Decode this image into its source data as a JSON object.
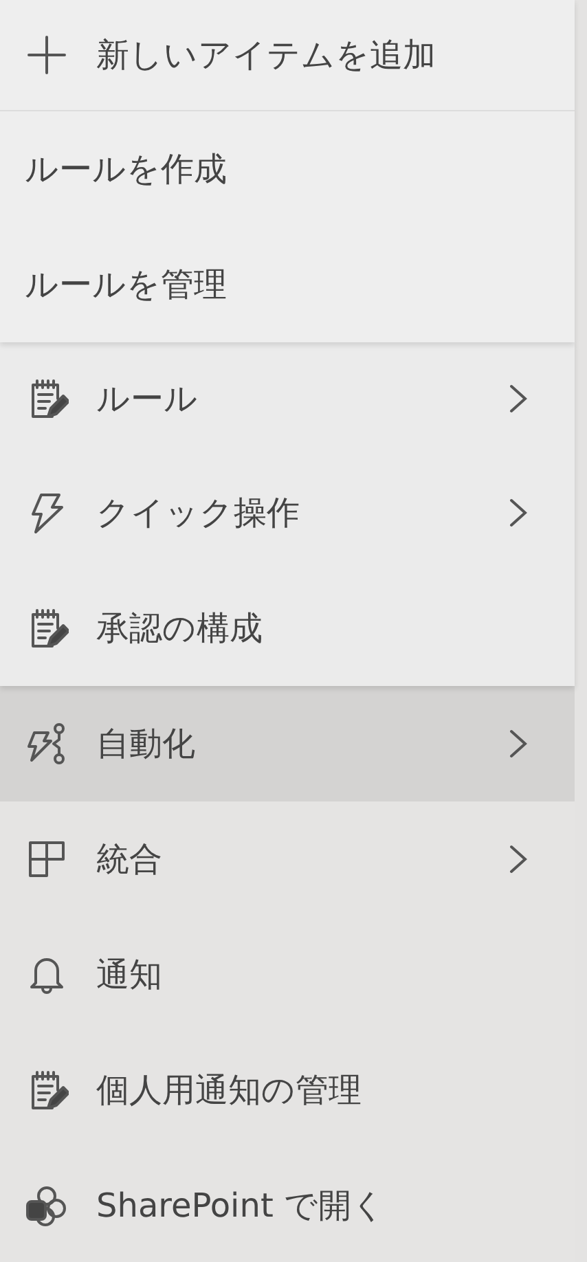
{
  "menus": [
    {
      "items": [
        {
          "kind": "plus",
          "label": "新しいアイテムを追加",
          "submenu": false,
          "selected": false
        },
        {
          "kind": "text",
          "label": "ルールを作成",
          "submenu": false,
          "selected": false
        },
        {
          "kind": "text",
          "label": "ルールを管理",
          "submenu": false,
          "selected": false
        }
      ]
    },
    {
      "items": [
        {
          "kind": "note",
          "label": "ルール",
          "submenu": true,
          "selected": false
        },
        {
          "kind": "bolt",
          "label": "クイック操作",
          "submenu": true,
          "selected": false
        },
        {
          "kind": "note",
          "label": "承認の構成",
          "submenu": false,
          "selected": false
        }
      ]
    },
    {
      "items": [
        {
          "kind": "flow",
          "label": "自動化",
          "submenu": true,
          "selected": true
        },
        {
          "kind": "grid",
          "label": "統合",
          "submenu": true,
          "selected": false
        },
        {
          "kind": "bell",
          "label": "通知",
          "submenu": false,
          "selected": false
        },
        {
          "kind": "note",
          "label": "個人用通知の管理",
          "submenu": false,
          "selected": false
        },
        {
          "kind": "sharepoint",
          "label": "SharePoint で開く",
          "submenu": false,
          "selected": false
        }
      ]
    }
  ]
}
